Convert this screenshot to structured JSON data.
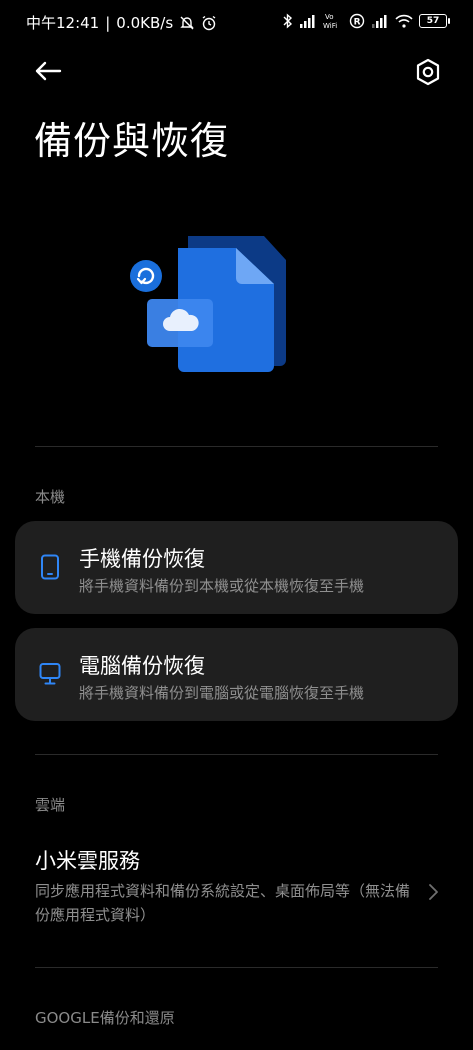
{
  "status_bar": {
    "time": "中午12:41",
    "network_speed": "0.0KB/s",
    "icons_left": [
      "mute-icon",
      "alarm-icon"
    ],
    "icons_right": [
      "bluetooth-icon",
      "signal-icon",
      "vowifi-icon",
      "registered-icon",
      "signal-icon",
      "wifi-icon"
    ],
    "vowifi_label": "Vo\nWiFi",
    "battery": "57"
  },
  "header": {
    "back_icon": "arrow-left-icon",
    "settings_icon": "settings-hexagon-icon",
    "title": "備份與恢復"
  },
  "hero": {
    "icon": "backup-files-cloud-illustration",
    "accent": "#1a73e8"
  },
  "local_section": {
    "label": "本機",
    "items": [
      {
        "icon": "phone-icon",
        "title": "手機備份恢復",
        "subtitle": "將手機資料備份到本機或從本機恢復至手機"
      },
      {
        "icon": "monitor-icon",
        "title": "電腦備份恢復",
        "subtitle": "將手機資料備份到電腦或從電腦恢復至手機"
      }
    ]
  },
  "cloud_section": {
    "label": "雲端",
    "item": {
      "title": "小米雲服務",
      "subtitle": "同步應用程式資料和備份系統設定、桌面佈局等（無法備份應用程式資料）",
      "chevron_icon": "chevron-right-icon"
    }
  },
  "google_section": {
    "label": "GOOGLE備份和還原"
  },
  "colors": {
    "background": "#000000",
    "card": "#1f1f1f",
    "accent": "#2f86f6",
    "secondary_text": "#8f8f8f",
    "section_label": "#8a8a8a"
  }
}
